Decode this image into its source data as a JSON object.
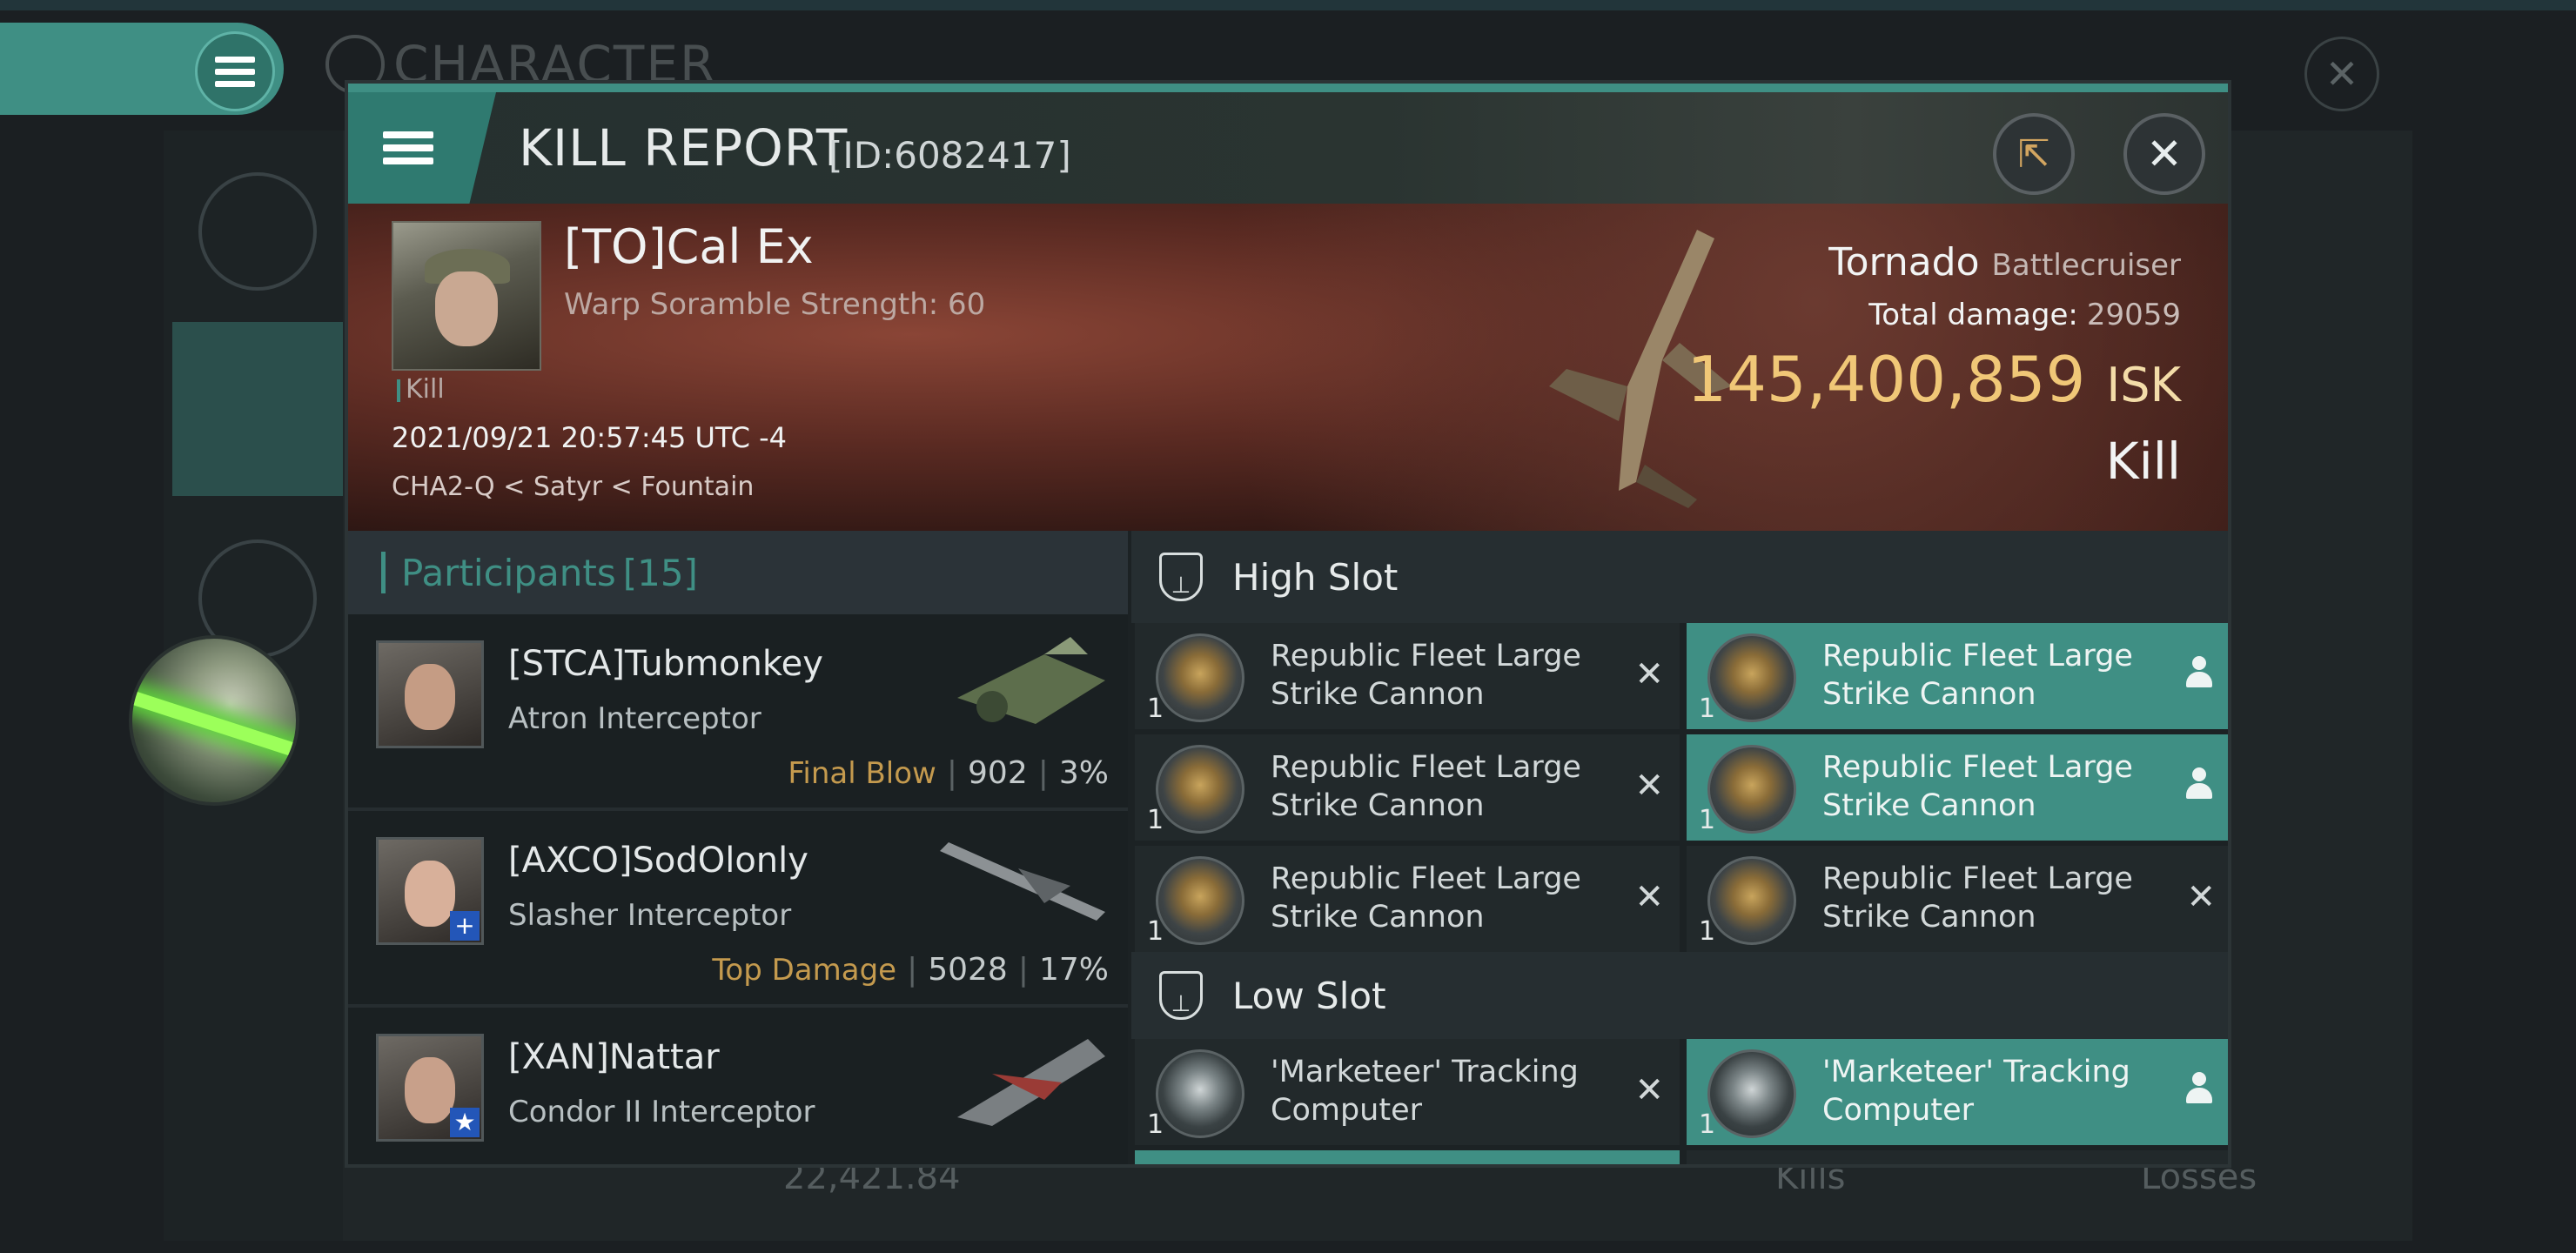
{
  "background": {
    "title": "CHARACTER",
    "footer": {
      "value": "22,421.84",
      "kills": "Kills",
      "losses": "Losses"
    }
  },
  "modal": {
    "title": "KILL REPORT",
    "id": "[ID:6082417]",
    "banner": {
      "pilot_name": "[TO]Cal Ex",
      "pilot_sub": "Warp Soramble Strength: 60",
      "tag": "Kill",
      "time": "2021/09/21 20:57:45 UTC -4",
      "location": "CHA2-Q < Satyr < Fountain",
      "victim_ship": "Tornado",
      "victim_class": "Battlecruiser",
      "total_damage_label": "Total damage:",
      "total_damage": "29059",
      "isk_value": "145,400,859",
      "isk_unit": "ISK",
      "result": "Kill"
    },
    "participants": {
      "label": "Participants",
      "count": "[15]",
      "rows": [
        {
          "name": "[STCA]Tubmonkey",
          "ship": "Atron Interceptor",
          "stat_label": "Final Blow",
          "damage": "902",
          "percent": "3%"
        },
        {
          "name": "[AXCO]SodOlonly",
          "ship": "Slasher Interceptor",
          "stat_label": "Top Damage",
          "damage": "5028",
          "percent": "17%"
        },
        {
          "name": "[XAN]Nattar",
          "ship": "Condor II Interceptor",
          "stat_label": "",
          "damage": "",
          "percent": ""
        }
      ]
    },
    "slots": {
      "high_label": "High Slot",
      "low_label": "Low Slot",
      "high": [
        {
          "name": "Republic Fleet Large Strike Cannon",
          "qty": "1",
          "state": "destroyed"
        },
        {
          "name": "Republic Fleet Large Strike Cannon",
          "qty": "1",
          "state": "dropped"
        },
        {
          "name": "Republic Fleet Large Strike Cannon",
          "qty": "1",
          "state": "destroyed"
        },
        {
          "name": "Republic Fleet Large Strike Cannon",
          "qty": "1",
          "state": "dropped"
        },
        {
          "name": "Republic Fleet Large Strike Cannon",
          "qty": "1",
          "state": "destroyed"
        },
        {
          "name": "Republic Fleet Large Strike Cannon",
          "qty": "1",
          "state": "destroyed"
        }
      ],
      "low": [
        {
          "name": "'Marketeer' Tracking Computer",
          "qty": "1",
          "state": "destroyed"
        },
        {
          "name": "'Marketeer' Tracking Computer",
          "qty": "1",
          "state": "dropped"
        }
      ]
    }
  },
  "colors": {
    "accent": "#3f8f84",
    "isk": "#f0c777",
    "stat_label": "#c49a4e"
  }
}
